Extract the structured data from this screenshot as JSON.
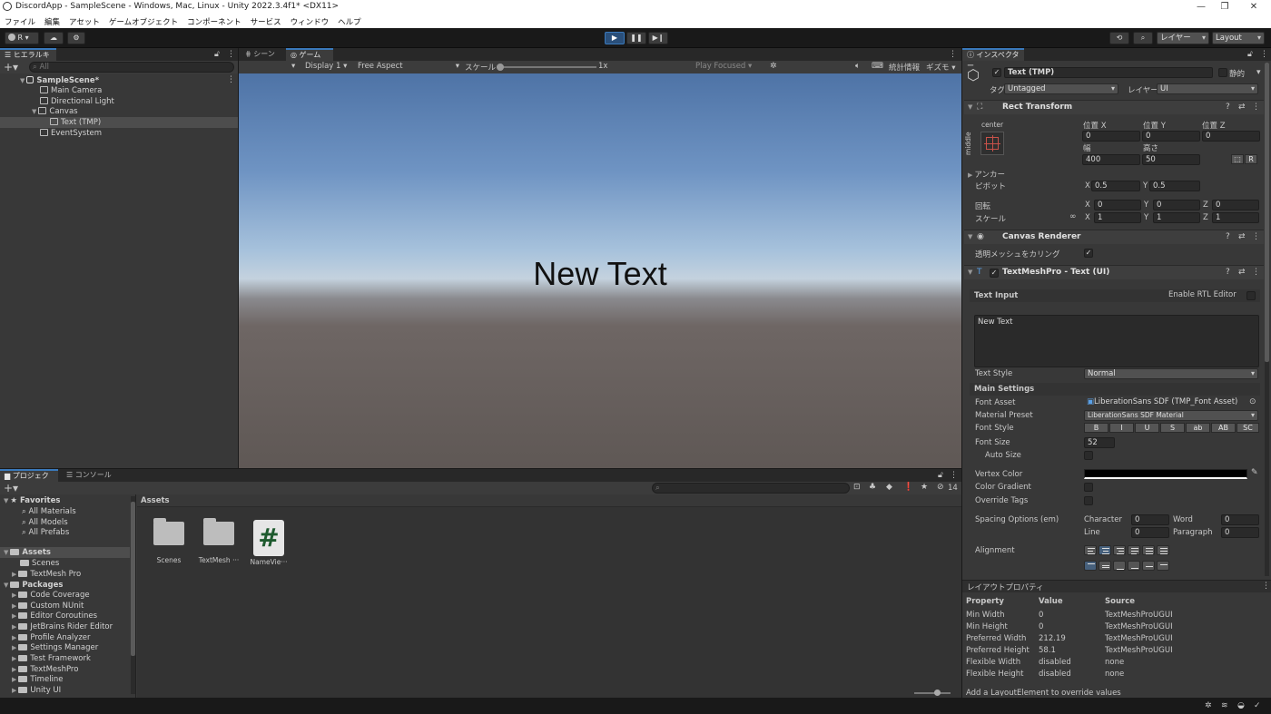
{
  "window": {
    "title": "DiscordApp - SampleScene - Windows, Mac, Linux - Unity 2022.3.4f1* <DX11>",
    "min": "—",
    "max": "❐",
    "close": "✕"
  },
  "menu": [
    "ファイル",
    "編集",
    "アセット",
    "ゲームオブジェクト",
    "コンポーネント",
    "サービス",
    "ウィンドウ",
    "ヘルプ"
  ],
  "toolbar": {
    "account": "R ▾",
    "layers": "レイヤー",
    "layout": "Layout"
  },
  "hierarchy": {
    "tab": "ヒエラルキー",
    "search_placeholder": "All",
    "items": [
      {
        "label": "SampleScene*",
        "depth": 0
      },
      {
        "label": "Main Camera",
        "depth": 1
      },
      {
        "label": "Directional Light",
        "depth": 1
      },
      {
        "label": "Canvas",
        "depth": 1
      },
      {
        "label": "Text (TMP)",
        "depth": 2
      },
      {
        "label": "EventSystem",
        "depth": 1
      }
    ]
  },
  "center": {
    "tabs": [
      "シーン",
      "ゲーム"
    ],
    "display": "Display 1",
    "aspect": "Free Aspect",
    "scale_label": "スケール",
    "scale_value": "1x",
    "play_focused": "Play Focused",
    "stats": "統計情報",
    "gizmos": "ギズモ",
    "game_text": "New Text"
  },
  "project": {
    "tabs": [
      "プロジェクト",
      "コンソール"
    ],
    "hidden_count": "14",
    "favorites_label": "Favorites",
    "favorites": [
      "All Materials",
      "All Models",
      "All Prefabs"
    ],
    "assets_label": "Assets",
    "assets_children": [
      "Scenes",
      "TextMesh Pro"
    ],
    "packages_label": "Packages",
    "packages": [
      "Code Coverage",
      "Custom NUnit",
      "Editor Coroutines",
      "JetBrains Rider Editor",
      "Profile Analyzer",
      "Settings Manager",
      "Test Framework",
      "TextMeshPro",
      "Timeline",
      "Unity UI"
    ],
    "breadcrumb": "Assets",
    "grid": [
      {
        "label": "Scenes",
        "icon": "folder"
      },
      {
        "label": "TextMesh ···",
        "icon": "folder"
      },
      {
        "label": "NameVie···",
        "icon": "script"
      }
    ]
  },
  "inspector": {
    "tab": "インスペクター",
    "object_name": "Text (TMP)",
    "static_label": "静的",
    "tag_label": "タグ",
    "tag_value": "Untagged",
    "layer_label": "レイヤー",
    "layer_value": "UI",
    "rect": {
      "title": "Rect Transform",
      "anchor_h": "center",
      "anchor_v": "middle",
      "posx_label": "位置 X",
      "posy_label": "位置 Y",
      "posz_label": "位置 Z",
      "posx": "0",
      "posy": "0",
      "posz": "0",
      "w_label": "幅",
      "h_label": "高さ",
      "w": "400",
      "h": "50",
      "r_btn": "R",
      "anchors_label": "アンカー",
      "pivot_label": "ピボット",
      "pivot_x": "0.5",
      "pivot_y": "0.5",
      "rotation_label": "回転",
      "rot_x": "0",
      "rot_y": "0",
      "rot_z": "0",
      "scale_label": "スケール",
      "sc_x": "1",
      "sc_y": "1",
      "sc_z": "1"
    },
    "canvas_renderer": {
      "title": "Canvas Renderer",
      "cull_label": "透明メッシュをカリング"
    },
    "tmp": {
      "title": "TextMeshPro - Text (UI)",
      "text_input_label": "Text Input",
      "rtl_label": "Enable RTL Editor",
      "text": "New Text",
      "text_style_label": "Text Style",
      "text_style": "Normal",
      "main_settings": "Main Settings",
      "font_asset_label": "Font Asset",
      "font_asset": "LiberationSans SDF (TMP_Font Asset)",
      "material_label": "Material Preset",
      "material": "LiberationSans SDF Material",
      "font_style_label": "Font Style",
      "font_styles": [
        "B",
        "I",
        "U",
        "S",
        "ab",
        "AB",
        "SC"
      ],
      "font_size_label": "Font Size",
      "font_size": "52",
      "auto_size_label": "Auto Size",
      "vertex_color_label": "Vertex Color",
      "vertex_color": "#000000",
      "color_gradient_label": "Color Gradient",
      "override_tags_label": "Override Tags",
      "spacing_label": "Spacing Options (em)",
      "character_label": "Character",
      "character": "0",
      "word_label": "Word",
      "word": "0",
      "line_label": "Line",
      "line": "0",
      "paragraph_label": "Paragraph",
      "paragraph": "0",
      "alignment_label": "Alignment"
    },
    "layout_props": {
      "title": "レイアウトプロパティ",
      "headers": [
        "Property",
        "Value",
        "Source"
      ],
      "rows": [
        [
          "Min Width",
          "0",
          "TextMeshProUGUI"
        ],
        [
          "Min Height",
          "0",
          "TextMeshProUGUI"
        ],
        [
          "Preferred Width",
          "212.19",
          "TextMeshProUGUI"
        ],
        [
          "Preferred Height",
          "58.1",
          "TextMeshProUGUI"
        ],
        [
          "Flexible Width",
          "disabled",
          "none"
        ],
        [
          "Flexible Height",
          "disabled",
          "none"
        ]
      ],
      "footer": "Add a LayoutElement to override values"
    }
  },
  "colors": {
    "accent": "#3a79bb",
    "panel": "#383838",
    "selection": "#46607c"
  }
}
